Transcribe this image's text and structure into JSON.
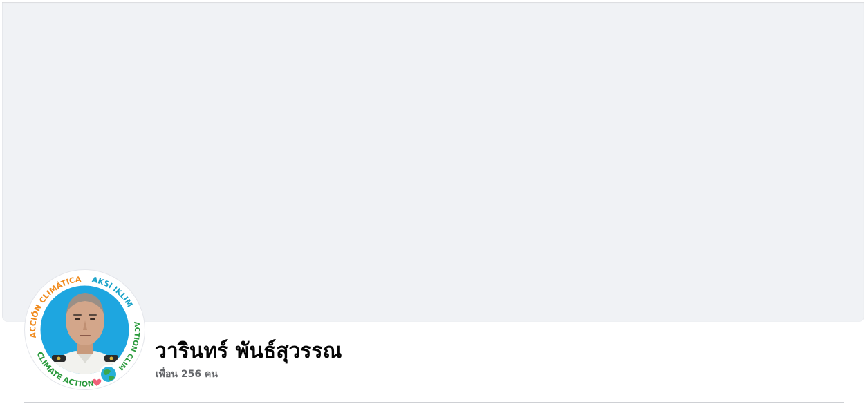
{
  "profile": {
    "name": "วารินทร์ พันธ์สุวรรณ",
    "friends_count_text": "เพื่อน 256 คน",
    "avatar": {
      "icon": "profile-photo-with-climate-action-frame",
      "frame_texts": {
        "top_left": "ACCIÓN CLIMÁTICA",
        "top_right": "AKSI IKLIM",
        "right": "ACTION CLIMAT",
        "bottom": "CLIMATE ACTION"
      }
    }
  },
  "colors": {
    "cover_background": "#f0f2f5",
    "name_text": "#050505",
    "secondary_text": "#65676b",
    "frame_orange": "#f08a1c",
    "frame_cyan": "#1aa3c9",
    "frame_green": "#2a9a3c",
    "photo_background": "#1ea6e0"
  }
}
